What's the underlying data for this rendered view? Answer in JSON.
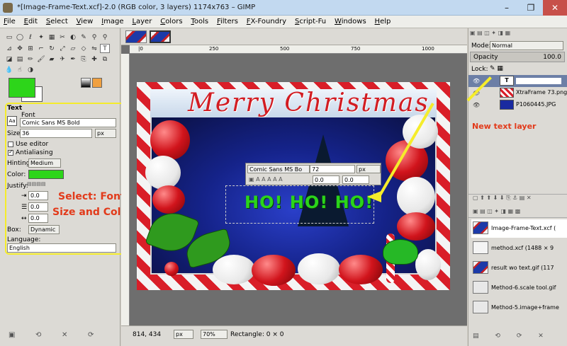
{
  "window": {
    "title": "*[Image-Frame-Text.xcf]-2.0 (RGB color, 3 layers) 1174x763 – GIMP",
    "controls": [
      "–",
      "❐",
      "✕"
    ]
  },
  "menu": [
    "File",
    "Edit",
    "Select",
    "View",
    "Image",
    "Layer",
    "Colors",
    "Tools",
    "Filters",
    "FX-Foundry",
    "Script-Fu",
    "Windows",
    "Help"
  ],
  "toolbox": {
    "fg_color": "#2dd51a",
    "bg_color": "#ffffff"
  },
  "tool_options": {
    "heading": "Text",
    "font_label": "Font",
    "font_preview": "Aa",
    "font_value": "Comic Sans MS Bold",
    "size_label": "Size:",
    "size_value": "36",
    "size_unit": "px",
    "use_editor_label": "Use editor",
    "antialiasing_label": "Antialiasing",
    "hinting_label": "Hinting",
    "hinting_value": "Medium",
    "color_label": "Color:",
    "color_value": "#2dd51a",
    "justify_label": "Justify:",
    "indent_value": "0.0",
    "linespacing_value": "0.0",
    "letterspacing_value": "0.0",
    "box_label": "Box:",
    "box_value": "Dynamic",
    "language_label": "Language:",
    "language_value": "English"
  },
  "annotations": {
    "left_line1": "Select: Font,",
    "left_line2": "Size and Color",
    "right": "New text layer"
  },
  "canvas": {
    "ruler_marks": [
      "|0",
      "250",
      "500",
      "750",
      "1000"
    ],
    "heading": "Merry Christmas",
    "text": "HO! HO! HO!",
    "onbar_font": "Comic Sans MS Bo",
    "onbar_size": "72",
    "onbar_unit": "px",
    "onbar_v1": "0.0",
    "onbar_v2": "0.0"
  },
  "statusbar": {
    "coords": "814, 434",
    "unit": "px",
    "zoom": "70%",
    "message": "Rectangle: 0 × 0"
  },
  "layers_panel": {
    "mode_label": "Mode:",
    "mode_value": "Normal",
    "opacity_label": "Opacity",
    "opacity_value": "100.0",
    "lock_label": "Lock:",
    "layers": [
      {
        "name": "",
        "type": "text"
      },
      {
        "name": "XtraFrame 73.png",
        "type": "frame"
      },
      {
        "name": "P1060445.JPG",
        "type": "photo"
      }
    ]
  },
  "history_panel": {
    "items": [
      "Image-Frame-Text.xcf (",
      "method.xcf (1488 × 9",
      "result wo text.gif (117",
      "Method-6.scale tool.gif",
      "Method-5.image+frame"
    ]
  }
}
